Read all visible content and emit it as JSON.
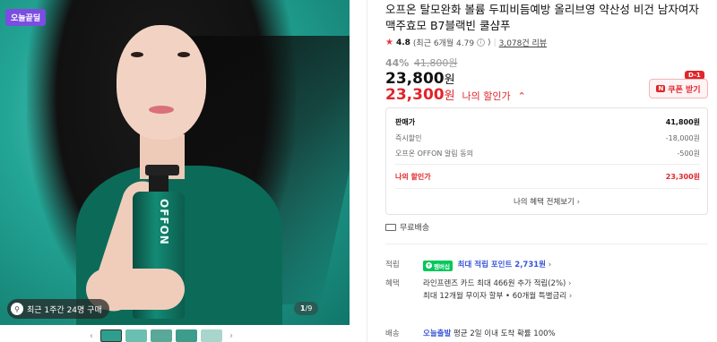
{
  "hero": {
    "badge": "오늘끝딜",
    "bottle_text": "OFFON",
    "purchase_pill": "최근 1주간 24명 구매",
    "counter_current": "1",
    "counter_total": "/9"
  },
  "thumbnails": {
    "prev": "‹",
    "next": "›",
    "count": 5
  },
  "product": {
    "title": "오프온 탈모완화 볼륨 두피비듬예방 올리브영 약산성 비건 남자여자 맥주효모 B7블랙빈 쿨샴푸",
    "rating": "4.8",
    "rating_recent": "(최근 6개월 4.79",
    "reviews": "3,078건 리뷰",
    "discount_pct": "44%",
    "original_price": "41,800원",
    "price": "23,800",
    "currency": "원",
    "my_price": "23,300",
    "my_price_label": "나의 할인가",
    "coupon_label": "쿠폰 받기",
    "coupon_day": "D-1"
  },
  "breakdown": {
    "rows": [
      {
        "label": "판매가",
        "value": "41,800원"
      },
      {
        "label": "즉시할인",
        "value": "-18,000원"
      },
      {
        "label": "오프온 OFFON 알림 동의",
        "value": "-500원"
      }
    ],
    "mine": {
      "label": "나의 할인가",
      "value": "23,300원"
    },
    "more": "나의 혜택 전체보기"
  },
  "shipping_free": "무료배송",
  "details": {
    "points_label": "적립",
    "points_badge": "멤버십",
    "points_text": "최대 적립 포인트 2,731원",
    "benefit_label": "혜택",
    "benefit_line1": "라인프렌즈 카드 최대 466원 추가 적립(2%)",
    "benefit_line2": "최대 12개월 무이자 할부 • 60개월 특별금리",
    "delivery_label": "배송",
    "delivery_brand": "오늘출발",
    "delivery_text": "평균 2일 이내 도착 확률 100%"
  },
  "colors": {
    "accent_red": "#e0252b",
    "naver_green": "#03c75a",
    "link_blue": "#3a55d8",
    "badge_purple": "#7b4de0"
  }
}
